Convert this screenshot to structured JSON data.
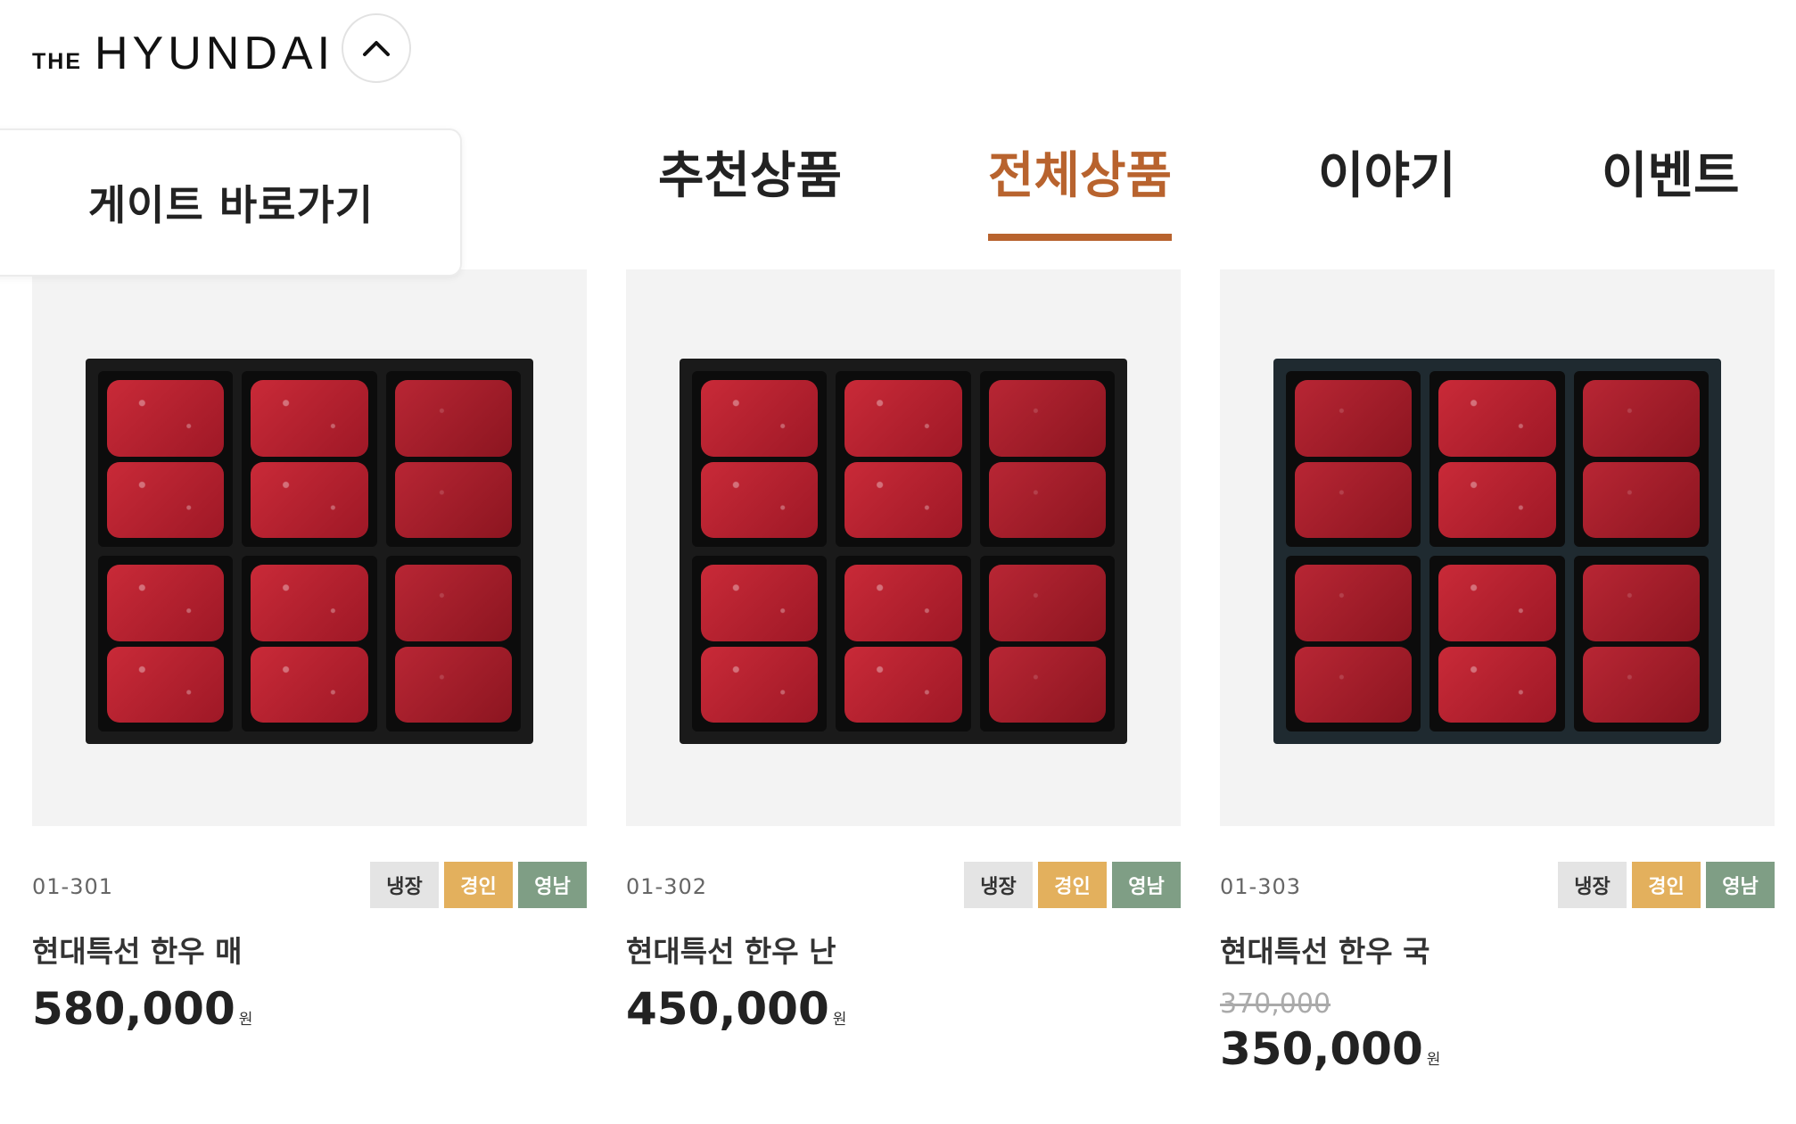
{
  "header": {
    "logo_prefix": "THE",
    "logo_main": "HYUNDAI",
    "toggle_icon": "chevron-up-icon"
  },
  "gate": {
    "label": "게이트 바로가기"
  },
  "nav": {
    "tabs": [
      {
        "label": "추천상품",
        "active": false
      },
      {
        "label": "전체상품",
        "active": true
      },
      {
        "label": "이야기",
        "active": false
      },
      {
        "label": "이벤트",
        "active": false
      }
    ]
  },
  "colors": {
    "accent": "#b8632e",
    "badge_cold": "#e4e4e4",
    "badge_kyungin": "#e3b05d",
    "badge_yeongnam": "#7f9e85"
  },
  "products": [
    {
      "code": "01-301",
      "badges": [
        "냉장",
        "경인",
        "영남"
      ],
      "name": "현대특선 한우 매",
      "original_price": "",
      "price": "580,000",
      "currency": "원"
    },
    {
      "code": "01-302",
      "badges": [
        "냉장",
        "경인",
        "영남"
      ],
      "name": "현대특선 한우 난",
      "original_price": "",
      "price": "450,000",
      "currency": "원"
    },
    {
      "code": "01-303",
      "badges": [
        "냉장",
        "경인",
        "영남"
      ],
      "name": "현대특선 한우 국",
      "original_price": "370,000",
      "price": "350,000",
      "currency": "원"
    }
  ]
}
